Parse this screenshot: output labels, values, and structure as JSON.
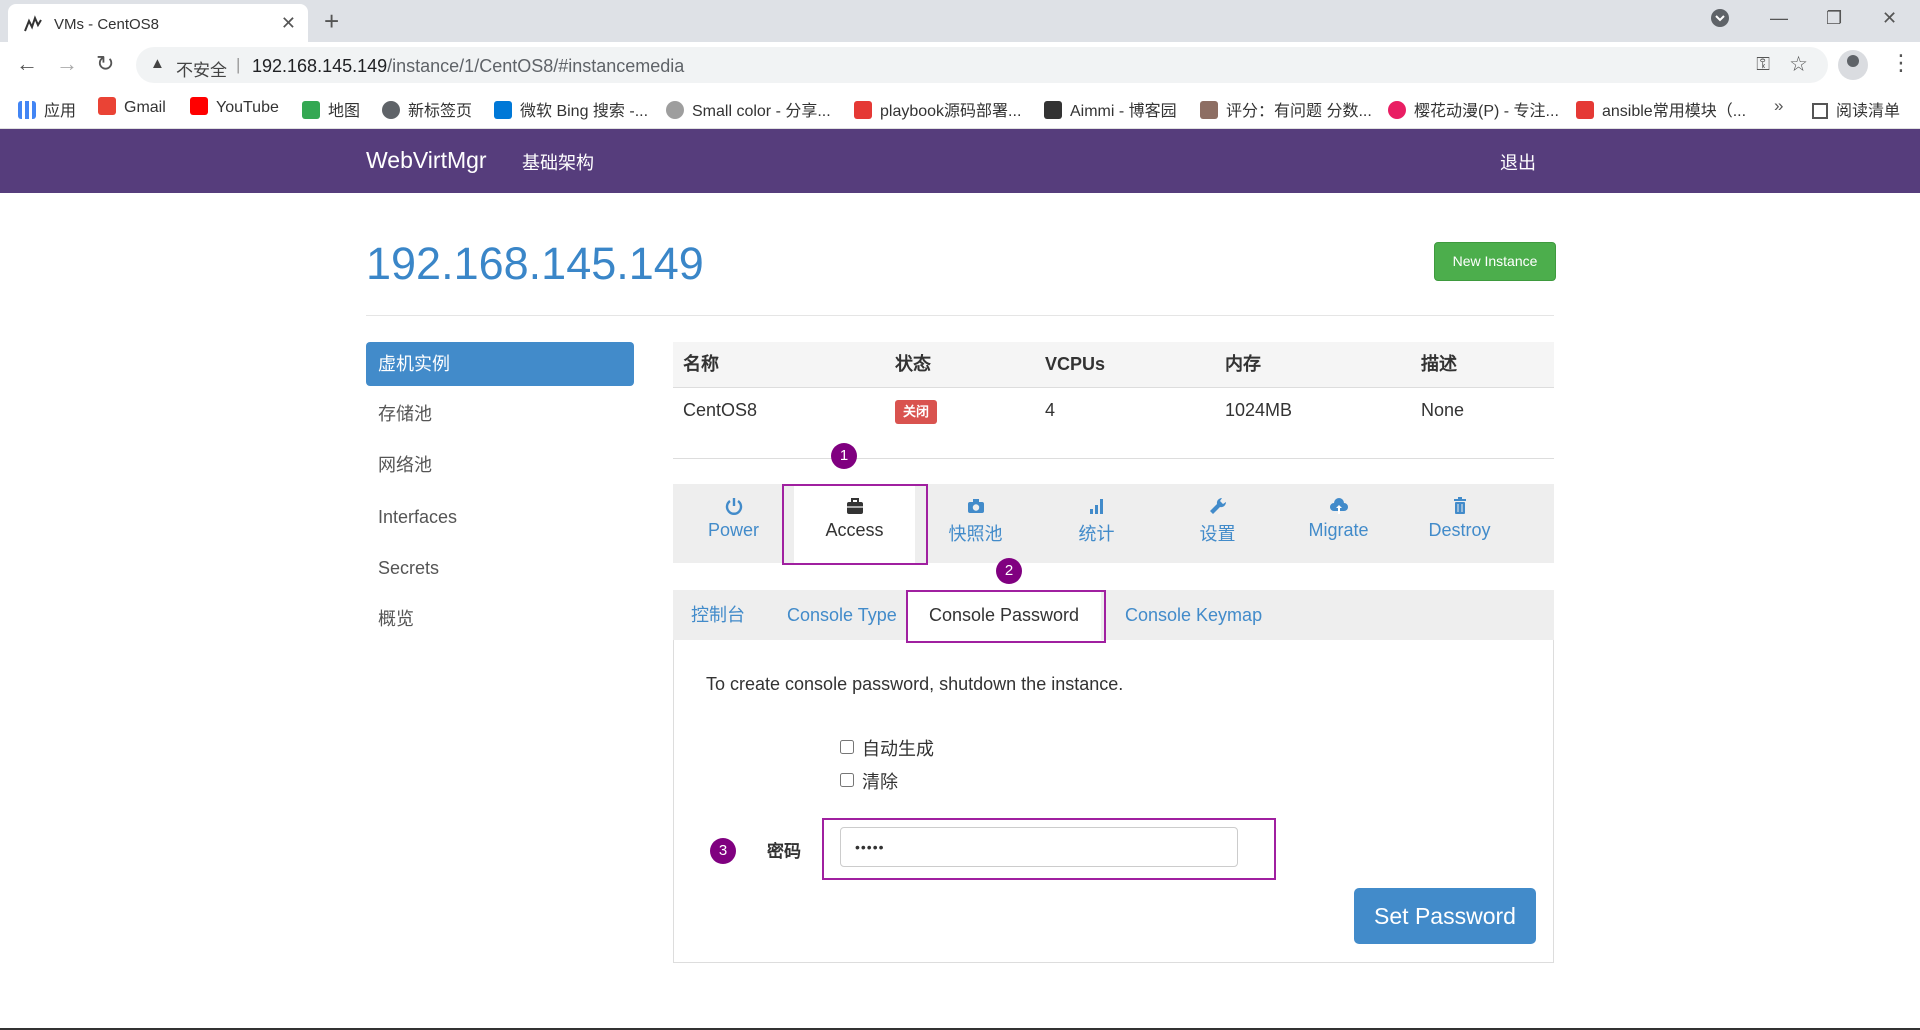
{
  "browser": {
    "tab_title": "VMs - CentOS8",
    "new_tab": "+",
    "insecure_label": "不安全",
    "url_host": "192.168.145.149",
    "url_path": "/instance/1/CentOS8/#instancemedia",
    "bookmarks": [
      {
        "label": "应用",
        "color": "#4285f4"
      },
      {
        "label": "Gmail",
        "color": "#ea4335"
      },
      {
        "label": "YouTube",
        "color": "#ff0000"
      },
      {
        "label": "地图",
        "color": "#34a853"
      },
      {
        "label": "新标签页",
        "color": "#5f6368"
      },
      {
        "label": "微软 Bing 搜索 -...",
        "color": "#0078d7"
      },
      {
        "label": "Small color - 分享...",
        "color": "#9e9e9e"
      },
      {
        "label": "playbook源码部署...",
        "color": "#e53935"
      },
      {
        "label": "Aimmi - 博客园",
        "color": "#333333"
      },
      {
        "label": "评分：有问题 分数...",
        "color": "#8d6e63"
      },
      {
        "label": "樱花动漫(P) - 专注...",
        "color": "#e91e63"
      },
      {
        "label": "ansible常用模块（...",
        "color": "#e53935"
      }
    ],
    "more": "»",
    "reading_list": "阅读清单"
  },
  "navbar": {
    "brand": "WebVirtMgr",
    "infrastructure": "基础架构",
    "logout": "退出"
  },
  "page": {
    "host": "192.168.145.149",
    "new_instance": "New Instance"
  },
  "sidebar": {
    "items": [
      {
        "label": "虚机实例"
      },
      {
        "label": "存储池"
      },
      {
        "label": "网络池"
      },
      {
        "label": "Interfaces"
      },
      {
        "label": "Secrets"
      },
      {
        "label": "概览"
      }
    ]
  },
  "vm_table": {
    "headers": [
      "名称",
      "状态",
      "VCPUs",
      "内存",
      "描述"
    ],
    "row": {
      "name": "CentOS8",
      "status": "关闭",
      "status_color": "#d9534f",
      "vcpus": "4",
      "memory": "1024MB",
      "description": "None"
    }
  },
  "actions": [
    {
      "label": "Power",
      "icon": "power-icon"
    },
    {
      "label": "Access",
      "icon": "briefcase-icon"
    },
    {
      "label": "快照池",
      "icon": "camera-icon"
    },
    {
      "label": "统计",
      "icon": "stats-icon"
    },
    {
      "label": "设置",
      "icon": "wrench-icon"
    },
    {
      "label": "Migrate",
      "icon": "cloud-upload-icon"
    },
    {
      "label": "Destroy",
      "icon": "trash-icon"
    }
  ],
  "subtabs": [
    "控制台",
    "Console Type",
    "Console Password",
    "Console Keymap"
  ],
  "console_password": {
    "message": "To create console password, shutdown the instance.",
    "auto_generate": "自动生成",
    "clear": "清除",
    "password_label": "密码",
    "password_value": "•••••",
    "submit": "Set Password"
  },
  "markers": [
    "1",
    "2",
    "3"
  ]
}
